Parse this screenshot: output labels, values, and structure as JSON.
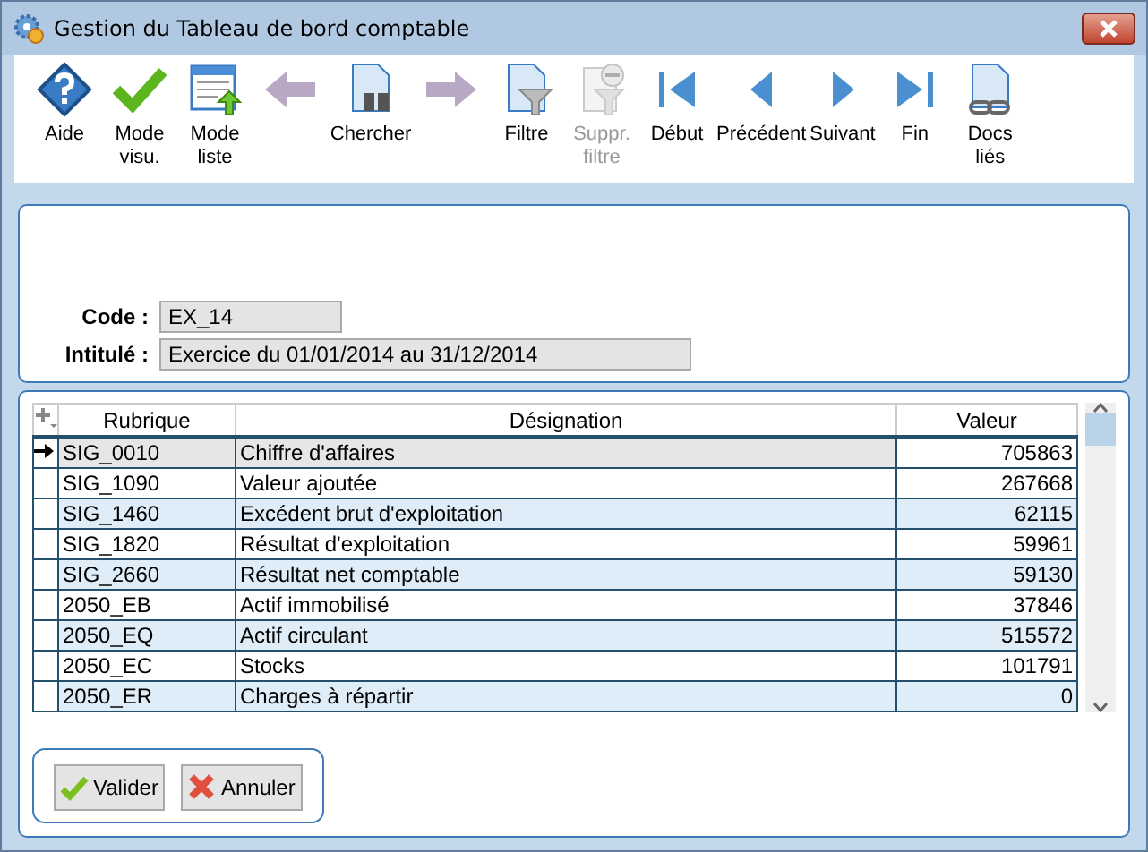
{
  "window": {
    "title": "Gestion du Tableau de bord comptable"
  },
  "toolbar": [
    {
      "kind": "help",
      "label": "Aide",
      "disabled": false
    },
    {
      "kind": "check",
      "label": "Mode visu.",
      "disabled": false
    },
    {
      "kind": "list",
      "label": "Mode liste",
      "disabled": false
    },
    {
      "kind": "back",
      "disabled": true
    },
    {
      "kind": "search",
      "label": "Chercher",
      "disabled": false
    },
    {
      "kind": "forward",
      "disabled": true
    },
    {
      "kind": "filter",
      "label": "Filtre",
      "disabled": false
    },
    {
      "kind": "unfilter",
      "label": "Suppr. filtre",
      "disabled": true
    },
    {
      "kind": "first",
      "label": "Début",
      "disabled": false
    },
    {
      "kind": "prev",
      "label": "Précédent",
      "disabled": false
    },
    {
      "kind": "next",
      "label": "Suivant",
      "disabled": false
    },
    {
      "kind": "last",
      "label": "Fin",
      "disabled": false
    },
    {
      "kind": "docs",
      "label": "Docs liés",
      "disabled": false
    }
  ],
  "fields": [
    {
      "label": "Code :",
      "value": "EX_14"
    },
    {
      "label": "Intitulé :",
      "value": "Exercice du 01/01/2014 au 31/12/2014"
    }
  ],
  "table": {
    "columns": [
      "Rubrique",
      "Désignation",
      "Valeur"
    ],
    "rows": [
      {
        "cells": [
          "SIG_0010",
          "Chiffre d'affaires",
          "705863"
        ],
        "selected": true
      },
      {
        "cells": [
          "SIG_1090",
          "Valeur ajoutée",
          "267668"
        ],
        "selected": false
      },
      {
        "cells": [
          "SIG_1460",
          "Excédent brut d'exploitation",
          "62115"
        ],
        "selected": false
      },
      {
        "cells": [
          "SIG_1820",
          "Résultat d'exploitation",
          "59961"
        ],
        "selected": false
      },
      {
        "cells": [
          "SIG_2660",
          "Résultat net comptable",
          "59130"
        ],
        "selected": false
      },
      {
        "cells": [
          "2050_EB",
          "Actif immobilisé",
          "37846"
        ],
        "selected": false
      },
      {
        "cells": [
          "2050_EQ",
          "Actif circulant",
          "515572"
        ],
        "selected": false
      },
      {
        "cells": [
          "2050_EC",
          "Stocks",
          "101791"
        ],
        "selected": false
      },
      {
        "cells": [
          "2050_ER",
          "Charges à répartir",
          "0"
        ],
        "selected": false
      }
    ]
  },
  "buttons": [
    {
      "kind": "ok",
      "label": "Valider"
    },
    {
      "kind": "cancel",
      "label": "Annuler"
    }
  ]
}
